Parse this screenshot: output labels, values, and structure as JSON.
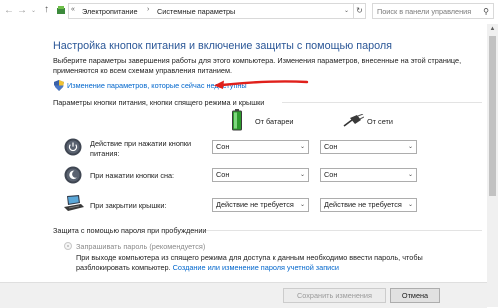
{
  "address_bar": {
    "crumbs": [
      "Электропитание",
      "Системные параметры"
    ],
    "search_placeholder": "Поиск в панели управления"
  },
  "main": {
    "title": "Настройка кнопок питания и включение защиты с помощью пароля",
    "description": "Выберите параметры завершения работы для этого компьютера. Изменения параметров, внесенные на этой странице, применяются ко всем схемам управления питанием.",
    "change_link": "Изменение параметров, которые сейчас недоступны",
    "section_buttons": "Параметры кнопки питания, кнопки спящего режима и крышки",
    "col_battery": "От батареи",
    "col_ac": "От сети",
    "rows": [
      {
        "label": "Действие при нажатии кнопки питания:",
        "battery": "Сон",
        "ac": "Сон",
        "icon": "power-icon"
      },
      {
        "label": "При нажатии кнопки сна:",
        "battery": "Сон",
        "ac": "Сон",
        "icon": "sleep-icon"
      },
      {
        "label": "При закрытии крышки:",
        "battery": "Действие не требуется",
        "ac": "Действие не требуется",
        "icon": "laptop-lid-icon"
      }
    ],
    "section_password": "Защита с помощью пароля при пробуждении",
    "radio_require": "Запрашивать пароль (рекомендуется)",
    "radio_require_desc": "При выходе компьютера из спящего режима для доступа к данным необходимо ввести пароль, чтобы разблокировать компьютер.",
    "create_password_link": "Создание или изменение пароля учетной записи"
  },
  "footer": {
    "save_label": "Сохранить изменения",
    "cancel_label": "Отмена"
  },
  "colors": {
    "title": "#2b5797",
    "link": "#0066cc",
    "arrow": "#e0201b"
  }
}
